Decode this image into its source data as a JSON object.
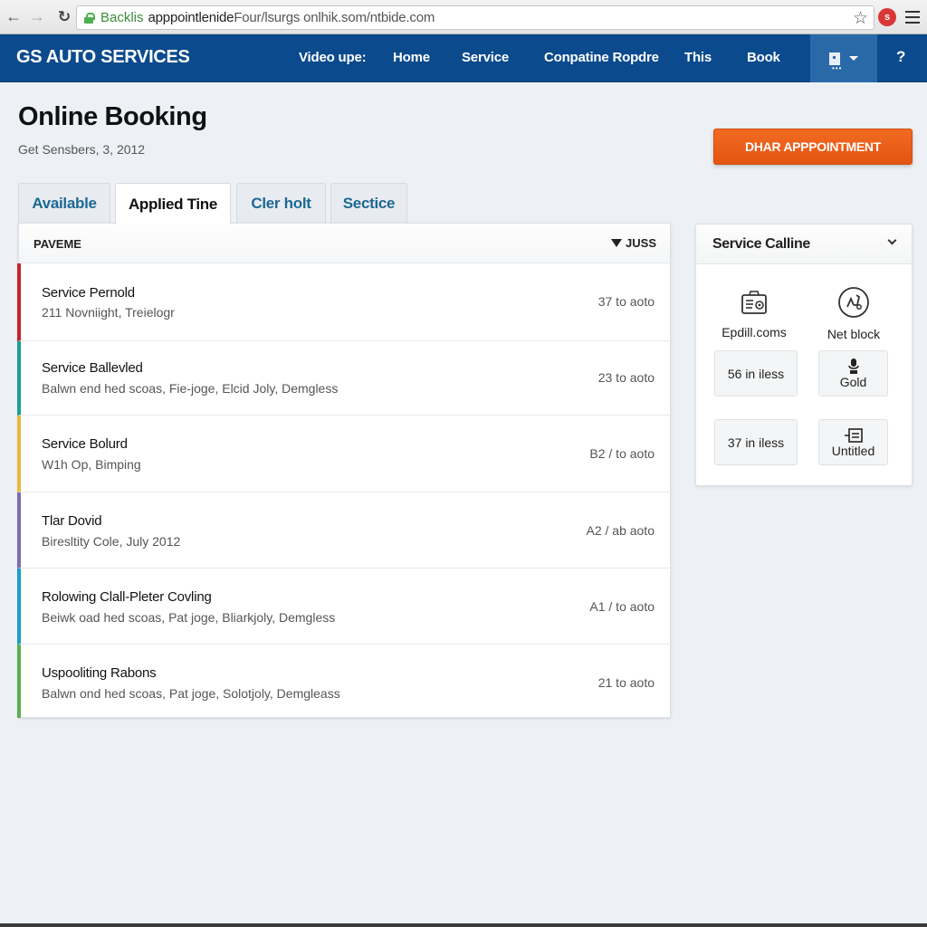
{
  "browser": {
    "url_secure_label": "Backlis",
    "url_host": "apppointlenide",
    "url_path": "Four/lsurgs onlhik.som/ntbide.com",
    "extension_badge": "s"
  },
  "header": {
    "brand": "GS AUTO SERVICES",
    "nav": [
      "Video upe:",
      "Home",
      "Service",
      "Conpatine Ropdre",
      "This",
      "Book"
    ],
    "help": "?"
  },
  "page": {
    "title": "Online Booking",
    "subtitle": "Get Sensbers, 3, 2012",
    "cta_label": "DHAR APPPOINTMENT",
    "accent_color": "#e85c18"
  },
  "tabs": [
    {
      "label": "Available",
      "active": false
    },
    {
      "label": "Applied Tine",
      "active": true
    },
    {
      "label": "Cler holt",
      "active": false
    },
    {
      "label": "Sectice",
      "active": false
    }
  ],
  "list": {
    "col_left": "PAVEME",
    "col_right": "JUSS",
    "rows": [
      {
        "title": "Service Pernold",
        "subtitle": "211 Novniight, Treielogr",
        "meta": "37 to aoto",
        "color": "#c8232c"
      },
      {
        "title": "Service Ballevled",
        "subtitle": "Balwn end hed scoas, Fie-joge, Elcid Joly, Demgless",
        "meta": "23 to aoto",
        "color": "#1f9e96"
      },
      {
        "title": "Service Bolurd",
        "subtitle": "W1h Op, Bimping",
        "meta": "B2 / to aoto",
        "color": "#e8b93a"
      },
      {
        "title": "Tlar Dovid",
        "subtitle": "Biresltity Cole, July 2012",
        "meta": "A2 / ab aoto",
        "color": "#7b6db4"
      },
      {
        "title": "Rolowing Clall-Pleter Covling",
        "subtitle": "Beiwk oad hed scoas, Pat joge, Bliarkjoly, Demgless",
        "meta": "A1 / to aoto",
        "color": "#1c9fc6"
      },
      {
        "title": "Uspooliting Rabons",
        "subtitle": "Balwn ond hed scoas, Pat joge, Solotjoly, Demgleass",
        "meta": "21 to aoto",
        "color": "#5bb04f"
      }
    ]
  },
  "sidebar": {
    "title": "Service Calline",
    "features": [
      {
        "label": "Epdill.coms",
        "icon": "id-card-icon"
      },
      {
        "label": "Net block",
        "icon": "scooter-icon"
      }
    ],
    "tiles": [
      {
        "label": "56 in iless"
      },
      {
        "label": "Gold",
        "icon": "microphone-icon"
      },
      {
        "label": "37 in iless"
      },
      {
        "label": "Untitled",
        "icon": "list-icon"
      }
    ]
  }
}
